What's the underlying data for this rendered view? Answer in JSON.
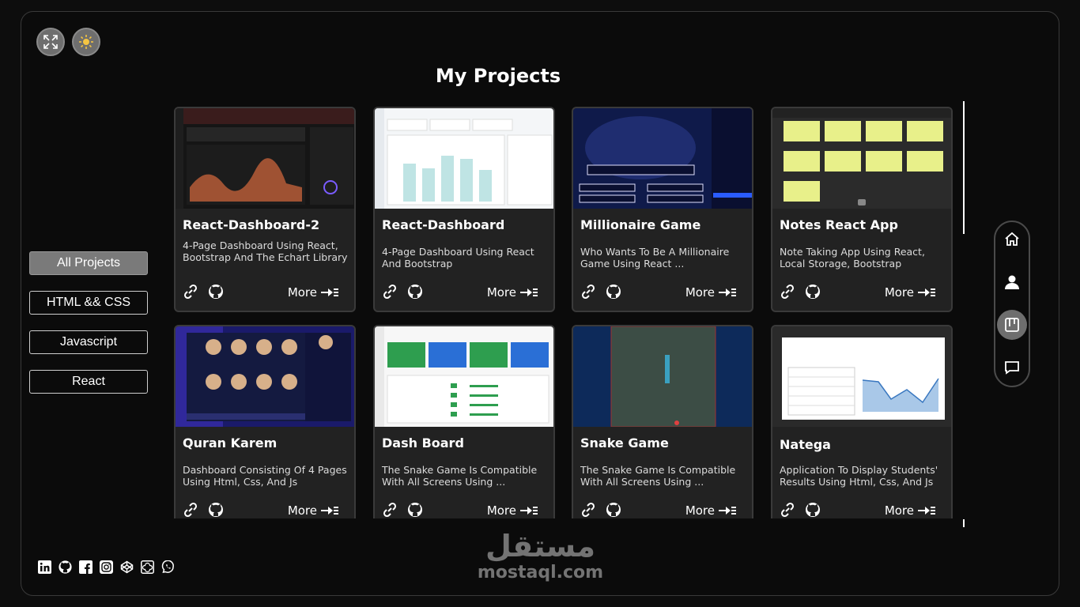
{
  "header": {
    "title": "My Projects"
  },
  "top_controls": {
    "fullscreen_icon": "expand-icon",
    "theme_icon": "sun-icon"
  },
  "filters": [
    {
      "label": "All Projects",
      "active": true
    },
    {
      "label": "HTML && CSS",
      "active": false
    },
    {
      "label": "Javascript",
      "active": false
    },
    {
      "label": "React",
      "active": false
    }
  ],
  "projects": [
    {
      "title": "React-Dashboard-2",
      "description": "4-Page Dashboard Using React, Bootstrap And The Echart Library",
      "more": "More"
    },
    {
      "title": "React-Dashboard",
      "description": "4-Page Dashboard Using React And Bootstrap",
      "more": "More"
    },
    {
      "title": "Millionaire Game",
      "description": "Who Wants To Be A Millionaire Game Using React ...",
      "more": "More"
    },
    {
      "title": "Notes React App",
      "description": "Note Taking App Using React, Local Storage, Bootstrap",
      "more": "More"
    },
    {
      "title": "Quran Karem",
      "description": "Dashboard Consisting Of 4 Pages Using Html, Css, And Js",
      "more": "More"
    },
    {
      "title": "Dash Board",
      "description": "The Snake Game Is Compatible With All Screens Using ...",
      "more": "More"
    },
    {
      "title": "Snake Game",
      "description": "The Snake Game Is Compatible With All Screens Using ...",
      "more": "More"
    },
    {
      "title": "Natega",
      "description": "Application To Display Students' Results Using Html, Css, And Js",
      "more": "More"
    }
  ],
  "side_nav": [
    {
      "icon": "home-icon",
      "active": false
    },
    {
      "icon": "user-icon",
      "active": false
    },
    {
      "icon": "projects-icon",
      "active": true
    },
    {
      "icon": "message-icon",
      "active": false
    }
  ],
  "socials": [
    "linkedin-icon",
    "github-icon",
    "facebook-icon",
    "instagram-icon",
    "codepen-icon",
    "codesandbox-icon",
    "whatsapp-icon"
  ],
  "watermark": {
    "arabic": "مستقل",
    "latin": "mostaql.com"
  }
}
